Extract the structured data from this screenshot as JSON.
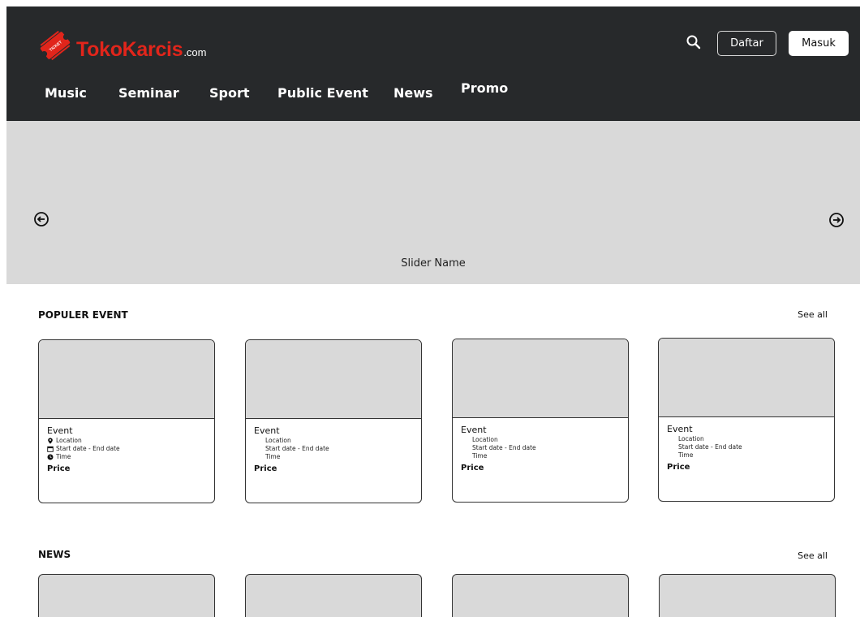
{
  "header": {
    "logo": {
      "name": "TokoKarcis",
      "domain": ".com",
      "badge": "TICKET",
      "color": "#e1251b"
    },
    "daftar_label": "Daftar",
    "masuk_label": "Masuk",
    "nav": [
      "Music",
      "Seminar",
      "Sport",
      "Public Event",
      "News",
      "Promo"
    ]
  },
  "slider": {
    "name": "Slider Name"
  },
  "popular": {
    "title": "POPULER EVENT",
    "see_all": "See all",
    "cards": [
      {
        "event": "Event",
        "location": "Location",
        "dates": "Start date - End date",
        "time": "Time",
        "price": "Price",
        "icons": true
      },
      {
        "event": "Event",
        "location": "Location",
        "dates": "Start date - End date",
        "time": "Time",
        "price": "Price",
        "icons": false
      },
      {
        "event": "Event",
        "location": "Location",
        "dates": "Start date - End date",
        "time": "Time",
        "price": "Price",
        "icons": false
      },
      {
        "event": "Event",
        "location": "Location",
        "dates": "Start date - End date",
        "time": "Time",
        "price": "Price",
        "icons": false
      }
    ]
  },
  "news": {
    "title": "NEWS",
    "see_all": "See all"
  },
  "colors": {
    "header_bg": "#27292b",
    "placeholder": "#d9d9d9",
    "brand_red": "#e1251b"
  }
}
